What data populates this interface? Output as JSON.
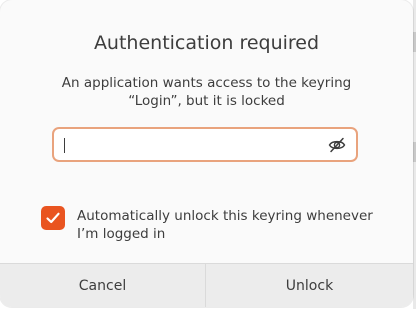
{
  "dialog": {
    "title": "Authentication required",
    "message_line1": "An application wants access to the keyring",
    "message_line2": "“Login”, but it is locked"
  },
  "password": {
    "value": "",
    "reveal_icon": "eye-slash-icon"
  },
  "auto_unlock": {
    "checked": true,
    "label_line1": "Automatically unlock this keyring whenever",
    "label_line2": "I’m logged in"
  },
  "buttons": {
    "cancel_label": "Cancel",
    "unlock_label": "Unlock"
  },
  "colors": {
    "accent": "#e95420",
    "focus_border": "#e9a37d",
    "text": "#3d3d3d",
    "button_bar": "#ececec"
  }
}
